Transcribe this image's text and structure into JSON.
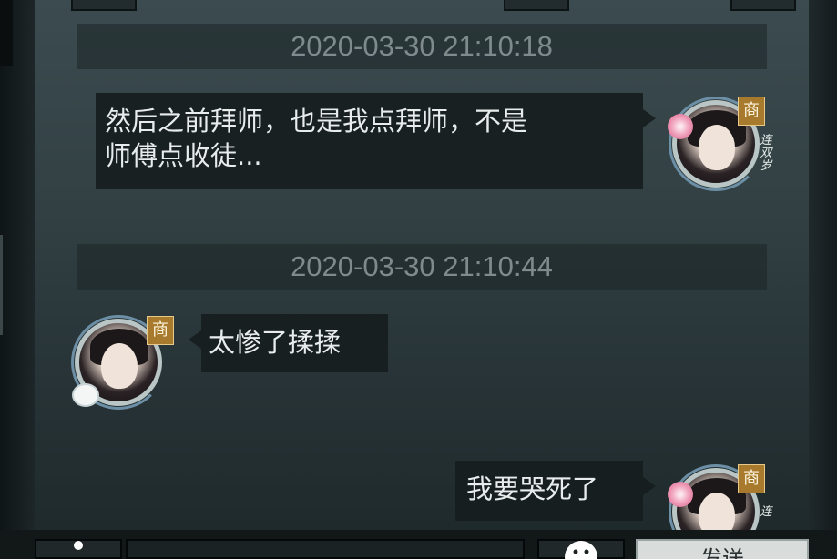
{
  "chat": {
    "messages": [
      {
        "timestamp": "2020-03-30 21:10:18",
        "side": "right",
        "lines": [
          "然后之前拜师，也是我点拜师，不是",
          "师傅点收徒..."
        ],
        "badge": "商",
        "side_text": "连双岁"
      },
      {
        "timestamp": "2020-03-30 21:10:44",
        "side": "left",
        "lines": [
          "太惨了揉揉"
        ],
        "badge": "商"
      },
      {
        "side": "right",
        "lines": [
          "我要哭死了"
        ],
        "badge": "商",
        "side_text": "连"
      }
    ]
  },
  "bottom_bar": {
    "send_label": "发送"
  },
  "icons": {
    "person": "person-icon",
    "emoji": "emoji-icon"
  },
  "colors": {
    "badge": "#a77a2d",
    "bubble": "#161d1e",
    "timestamp_text": "#7e8a8c"
  }
}
